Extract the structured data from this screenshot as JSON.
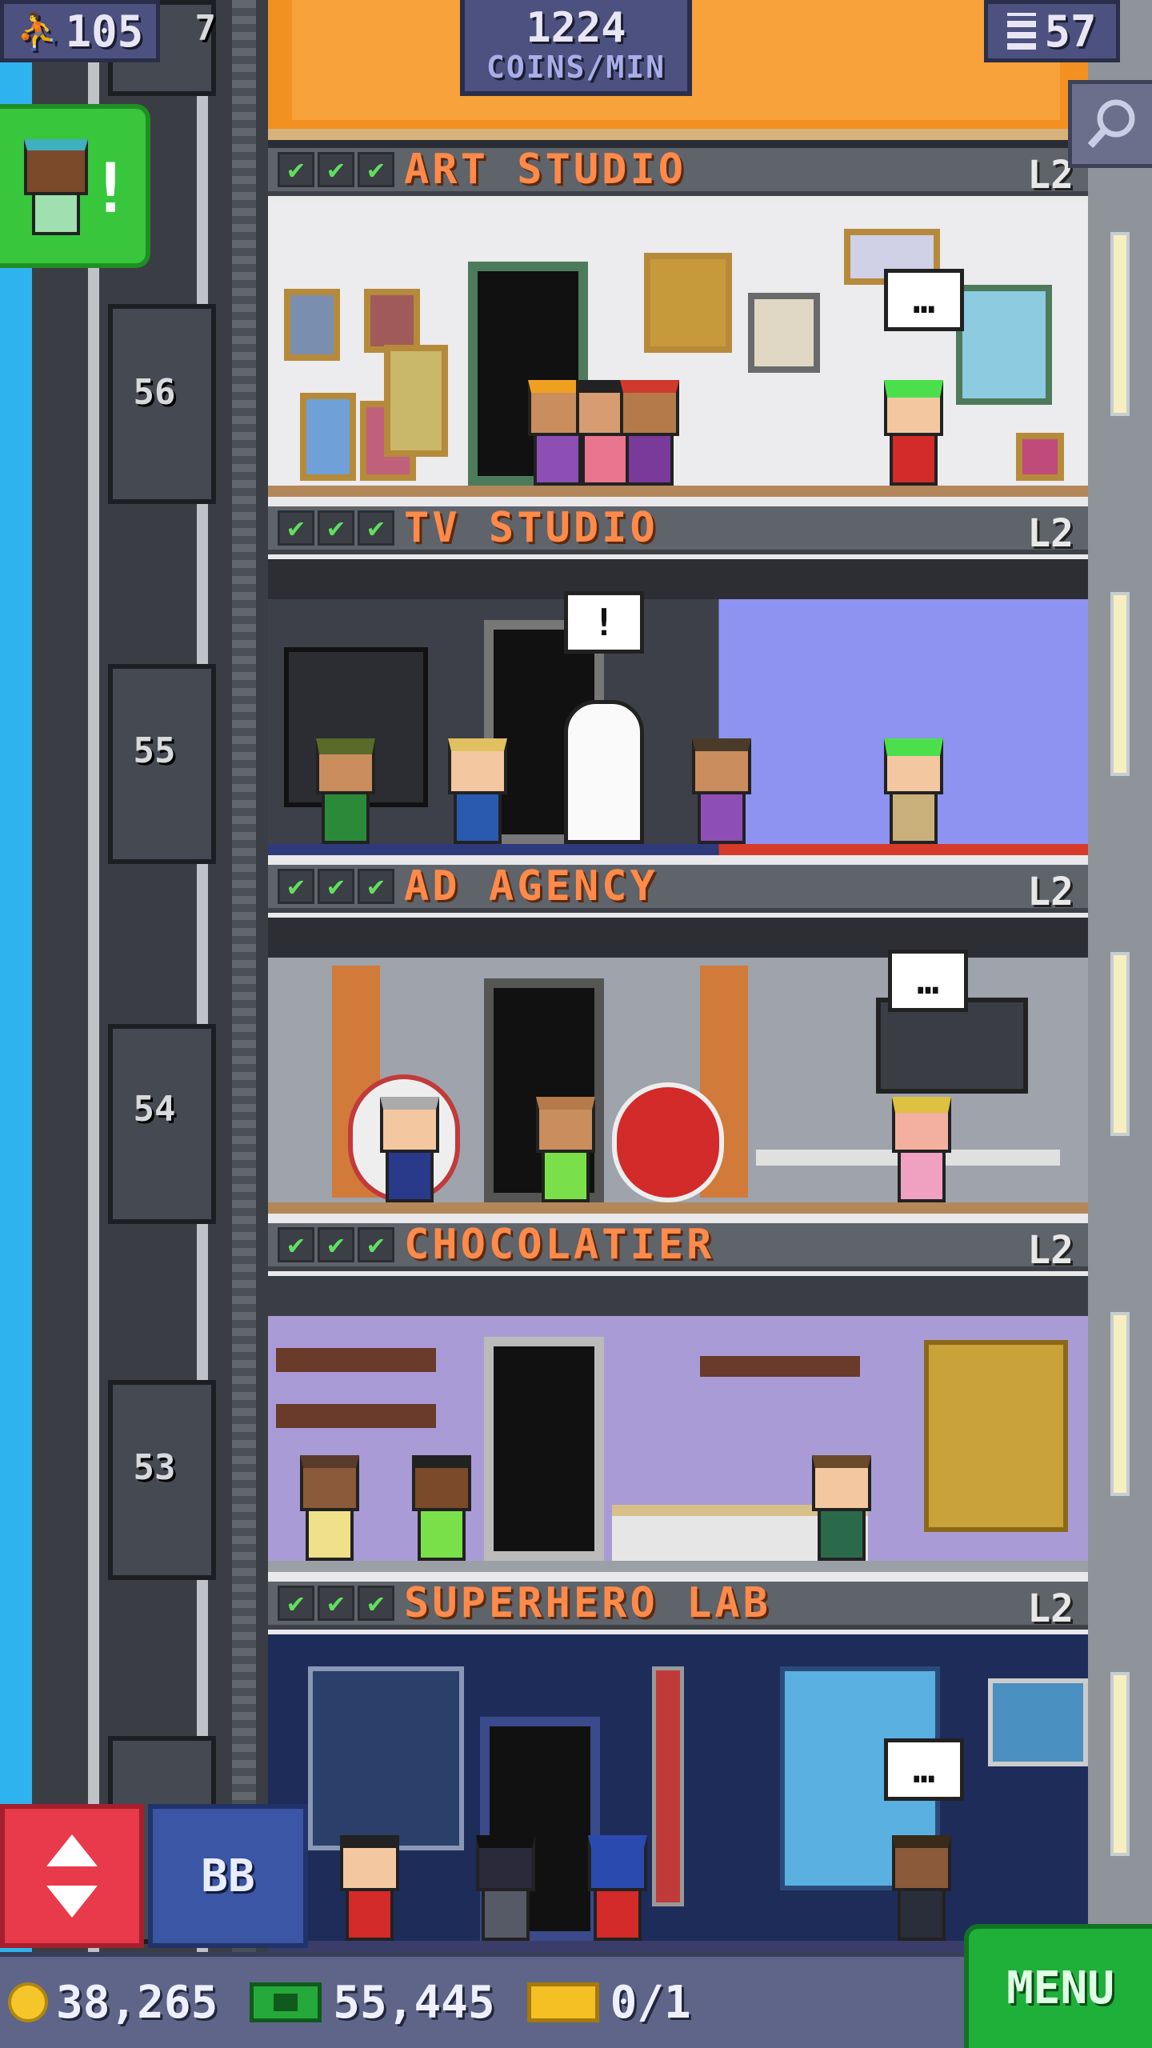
{
  "hud": {
    "population": "105",
    "coins_per_min_value": "1224",
    "coins_per_min_unit": "COINS/MIN",
    "floor_count": "57",
    "top_floor_number_partial": "7"
  },
  "visitor": {
    "alert": "!"
  },
  "elevator_floor_numbers": [
    "56",
    "55",
    "54",
    "53"
  ],
  "floors": [
    {
      "name": "ART STUDIO",
      "level": "L2",
      "checks": [
        "✔",
        "✔",
        "✔"
      ],
      "bubble": ""
    },
    {
      "name": "TV STUDIO",
      "level": "L2",
      "checks": [
        "✔",
        "✔",
        "✔"
      ],
      "bubble": "!"
    },
    {
      "name": "AD AGENCY",
      "level": "L2",
      "checks": [
        "✔",
        "✔",
        "✔"
      ],
      "bubble": ""
    },
    {
      "name": "CHOCOLATIER",
      "level": "L2",
      "checks": [
        "✔",
        "✔",
        "✔"
      ],
      "bubble": ""
    },
    {
      "name": "SUPERHERO LAB",
      "level": "L2",
      "checks": [
        "✔",
        "✔",
        "✔"
      ],
      "bubble": ""
    }
  ],
  "controls": {
    "bb_label": "BB",
    "menu_label": "MENU"
  },
  "currency": {
    "coins": "38,265",
    "bux": "55,445",
    "tickets": "0/1"
  },
  "colors": {
    "coin": "#f6c52a",
    "bux": "#25a93b",
    "menu": "#1fb03a",
    "elevator_button": "#e83a4b",
    "bb_button": "#3a56a4",
    "floor_title": "#ff8a4a"
  },
  "icons": [
    "population-icon",
    "floors-icon",
    "search-icon",
    "elevator-arrows-icon",
    "coin-icon",
    "bux-icon",
    "ticket-icon"
  ]
}
